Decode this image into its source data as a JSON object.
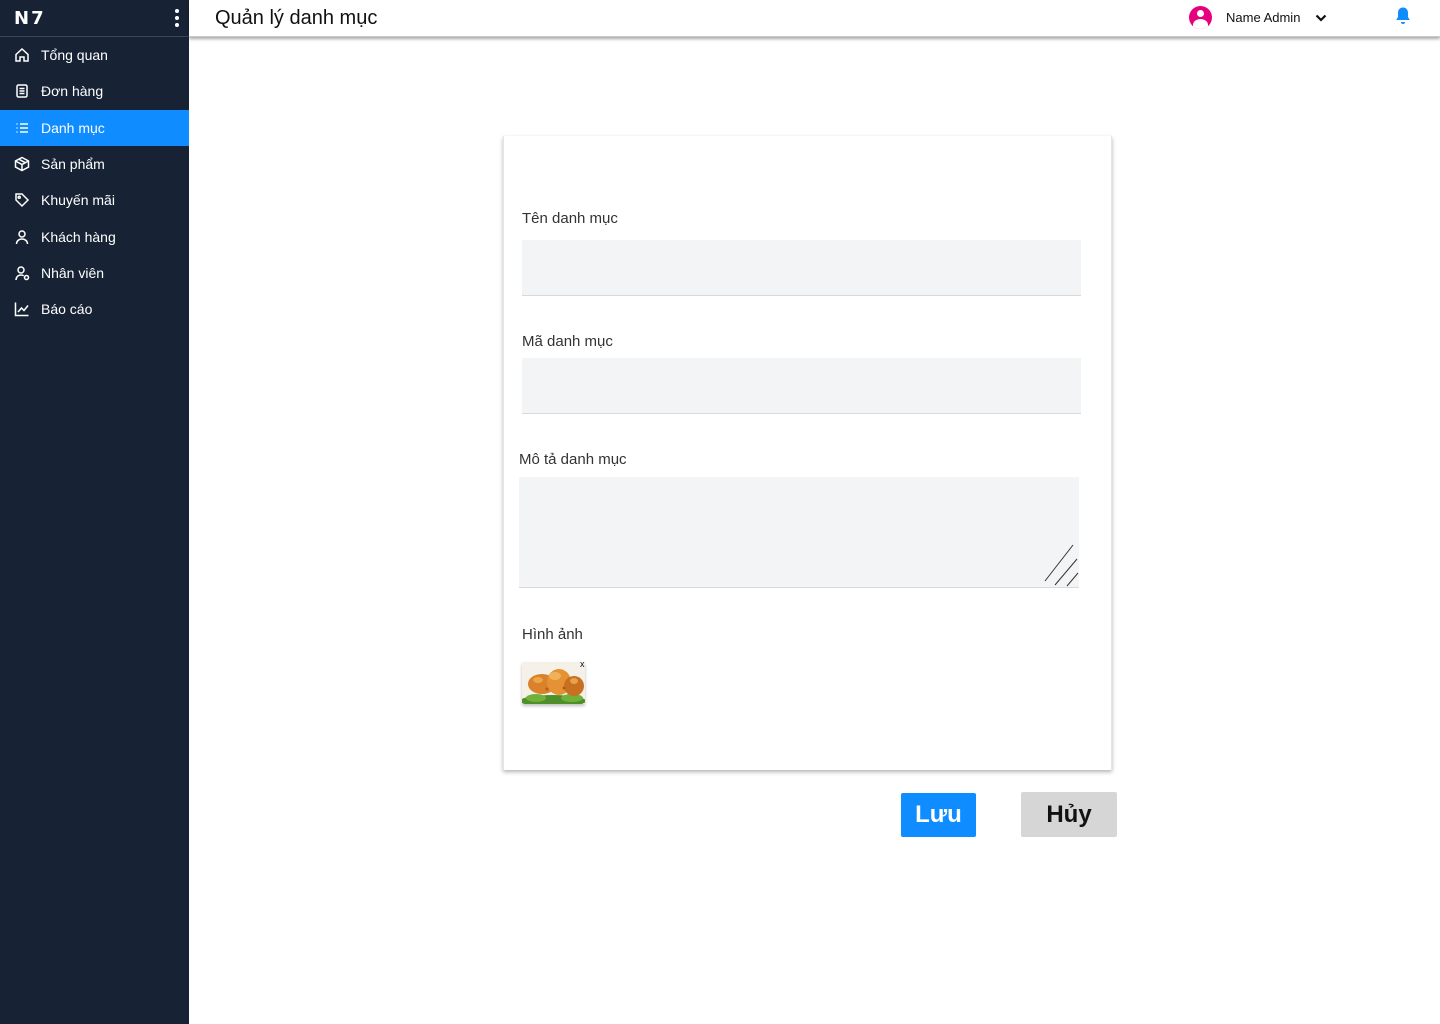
{
  "sidebar": {
    "logo": "N7",
    "items": [
      {
        "label": "Tổng quan",
        "icon": "home-icon"
      },
      {
        "label": "Đơn hàng",
        "icon": "document-icon"
      },
      {
        "label": "Danh mục",
        "icon": "list-icon",
        "active": true
      },
      {
        "label": "Sản phẩm",
        "icon": "box-icon"
      },
      {
        "label": "Khuyến mãi",
        "icon": "tag-icon"
      },
      {
        "label": "Khách hàng",
        "icon": "user-icon"
      },
      {
        "label": "Nhân viên",
        "icon": "user-badge-icon"
      },
      {
        "label": "Báo cáo",
        "icon": "chart-line-icon"
      }
    ]
  },
  "header": {
    "title": "Quản lý danh mục",
    "user_name": "Name Admin"
  },
  "form": {
    "name_label": "Tên danh mục",
    "name_value": "",
    "code_label": "Mã danh mục",
    "code_value": "",
    "description_label": "Mô tả danh mục",
    "description_value": "",
    "image_label": "Hình ảnh",
    "image_remove": "x"
  },
  "actions": {
    "save_label": "Lưu",
    "cancel_label": "Hủy"
  },
  "colors": {
    "sidebar_bg": "#172335",
    "accent": "#0f8cff",
    "avatar": "#e6007e",
    "input_bg": "#f3f4f6",
    "cancel_bg": "#d6d6d6"
  }
}
